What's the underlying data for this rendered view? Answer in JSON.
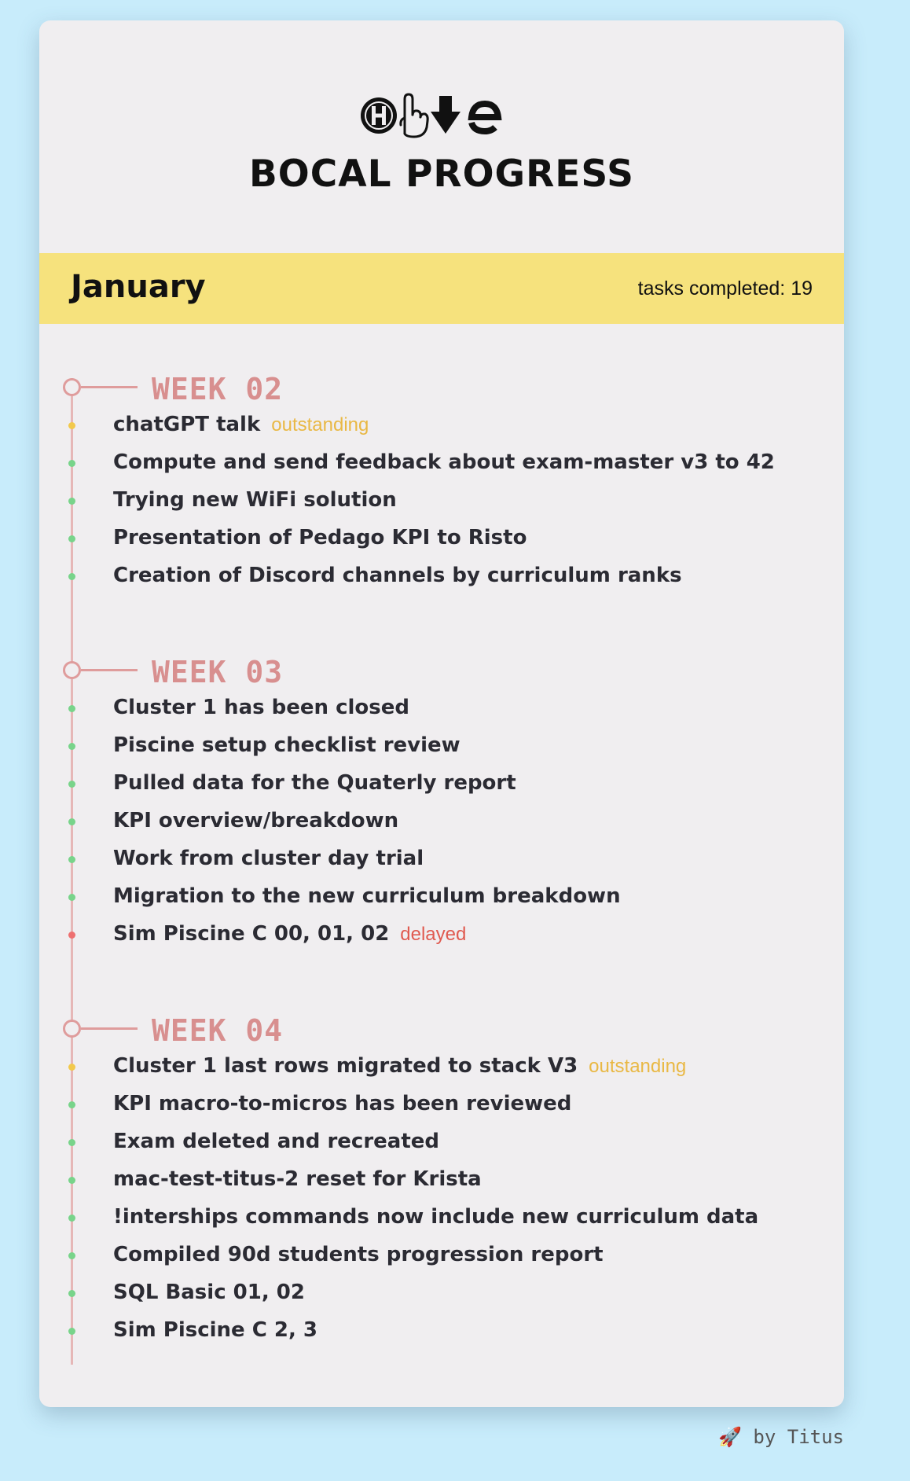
{
  "header": {
    "title": "BOCAL PROGRESS",
    "logo_name": "hive-logo"
  },
  "month": {
    "name": "January",
    "tasks_completed": "tasks completed: 19"
  },
  "colors": {
    "background": "#c8ecfb",
    "card": "#f0eef0",
    "month_bar": "#f6e27d",
    "week_accent": "#d88f8f",
    "done": "#78d48a",
    "outstanding": "#e9b844",
    "delayed": "#e05a50"
  },
  "weeks": [
    {
      "label": "WEEK 02",
      "tasks": [
        {
          "text": "chatGPT talk",
          "status": "outstanding",
          "status_label": "outstanding"
        },
        {
          "text": "Compute and send feedback about exam-master v3 to 42",
          "status": "done",
          "status_label": ""
        },
        {
          "text": "Trying new WiFi solution",
          "status": "done",
          "status_label": ""
        },
        {
          "text": "Presentation of Pedago KPI to Risto",
          "status": "done",
          "status_label": ""
        },
        {
          "text": "Creation of Discord channels by curriculum ranks",
          "status": "done",
          "status_label": ""
        }
      ]
    },
    {
      "label": "WEEK 03",
      "tasks": [
        {
          "text": "Cluster 1 has been closed",
          "status": "done",
          "status_label": ""
        },
        {
          "text": "Piscine setup checklist review",
          "status": "done",
          "status_label": ""
        },
        {
          "text": "Pulled data for the Quaterly report",
          "status": "done",
          "status_label": ""
        },
        {
          "text": "KPI overview/breakdown",
          "status": "done",
          "status_label": ""
        },
        {
          "text": "Work from cluster day trial",
          "status": "done",
          "status_label": ""
        },
        {
          "text": "Migration to the new curriculum breakdown",
          "status": "done",
          "status_label": ""
        },
        {
          "text": "Sim Piscine C 00, 01, 02",
          "status": "delayed",
          "status_label": "delayed"
        }
      ]
    },
    {
      "label": "WEEK 04",
      "tasks": [
        {
          "text": "Cluster 1 last rows migrated to stack V3",
          "status": "outstanding",
          "status_label": "outstanding"
        },
        {
          "text": "KPI macro-to-micros has been reviewed",
          "status": "done",
          "status_label": ""
        },
        {
          "text": "Exam deleted and recreated",
          "status": "done",
          "status_label": ""
        },
        {
          "text": "mac-test-titus-2 reset for Krista",
          "status": "done",
          "status_label": ""
        },
        {
          "text": "!interships commands now include new curriculum data",
          "status": "done",
          "status_label": ""
        },
        {
          "text": "Compiled 90d students progression report",
          "status": "done",
          "status_label": ""
        },
        {
          "text": "SQL Basic 01, 02",
          "status": "done",
          "status_label": ""
        },
        {
          "text": "Sim Piscine C 2, 3",
          "status": "done",
          "status_label": ""
        }
      ]
    }
  ],
  "footer": {
    "text": "🚀 by Titus",
    "icon": "rocket-icon"
  }
}
